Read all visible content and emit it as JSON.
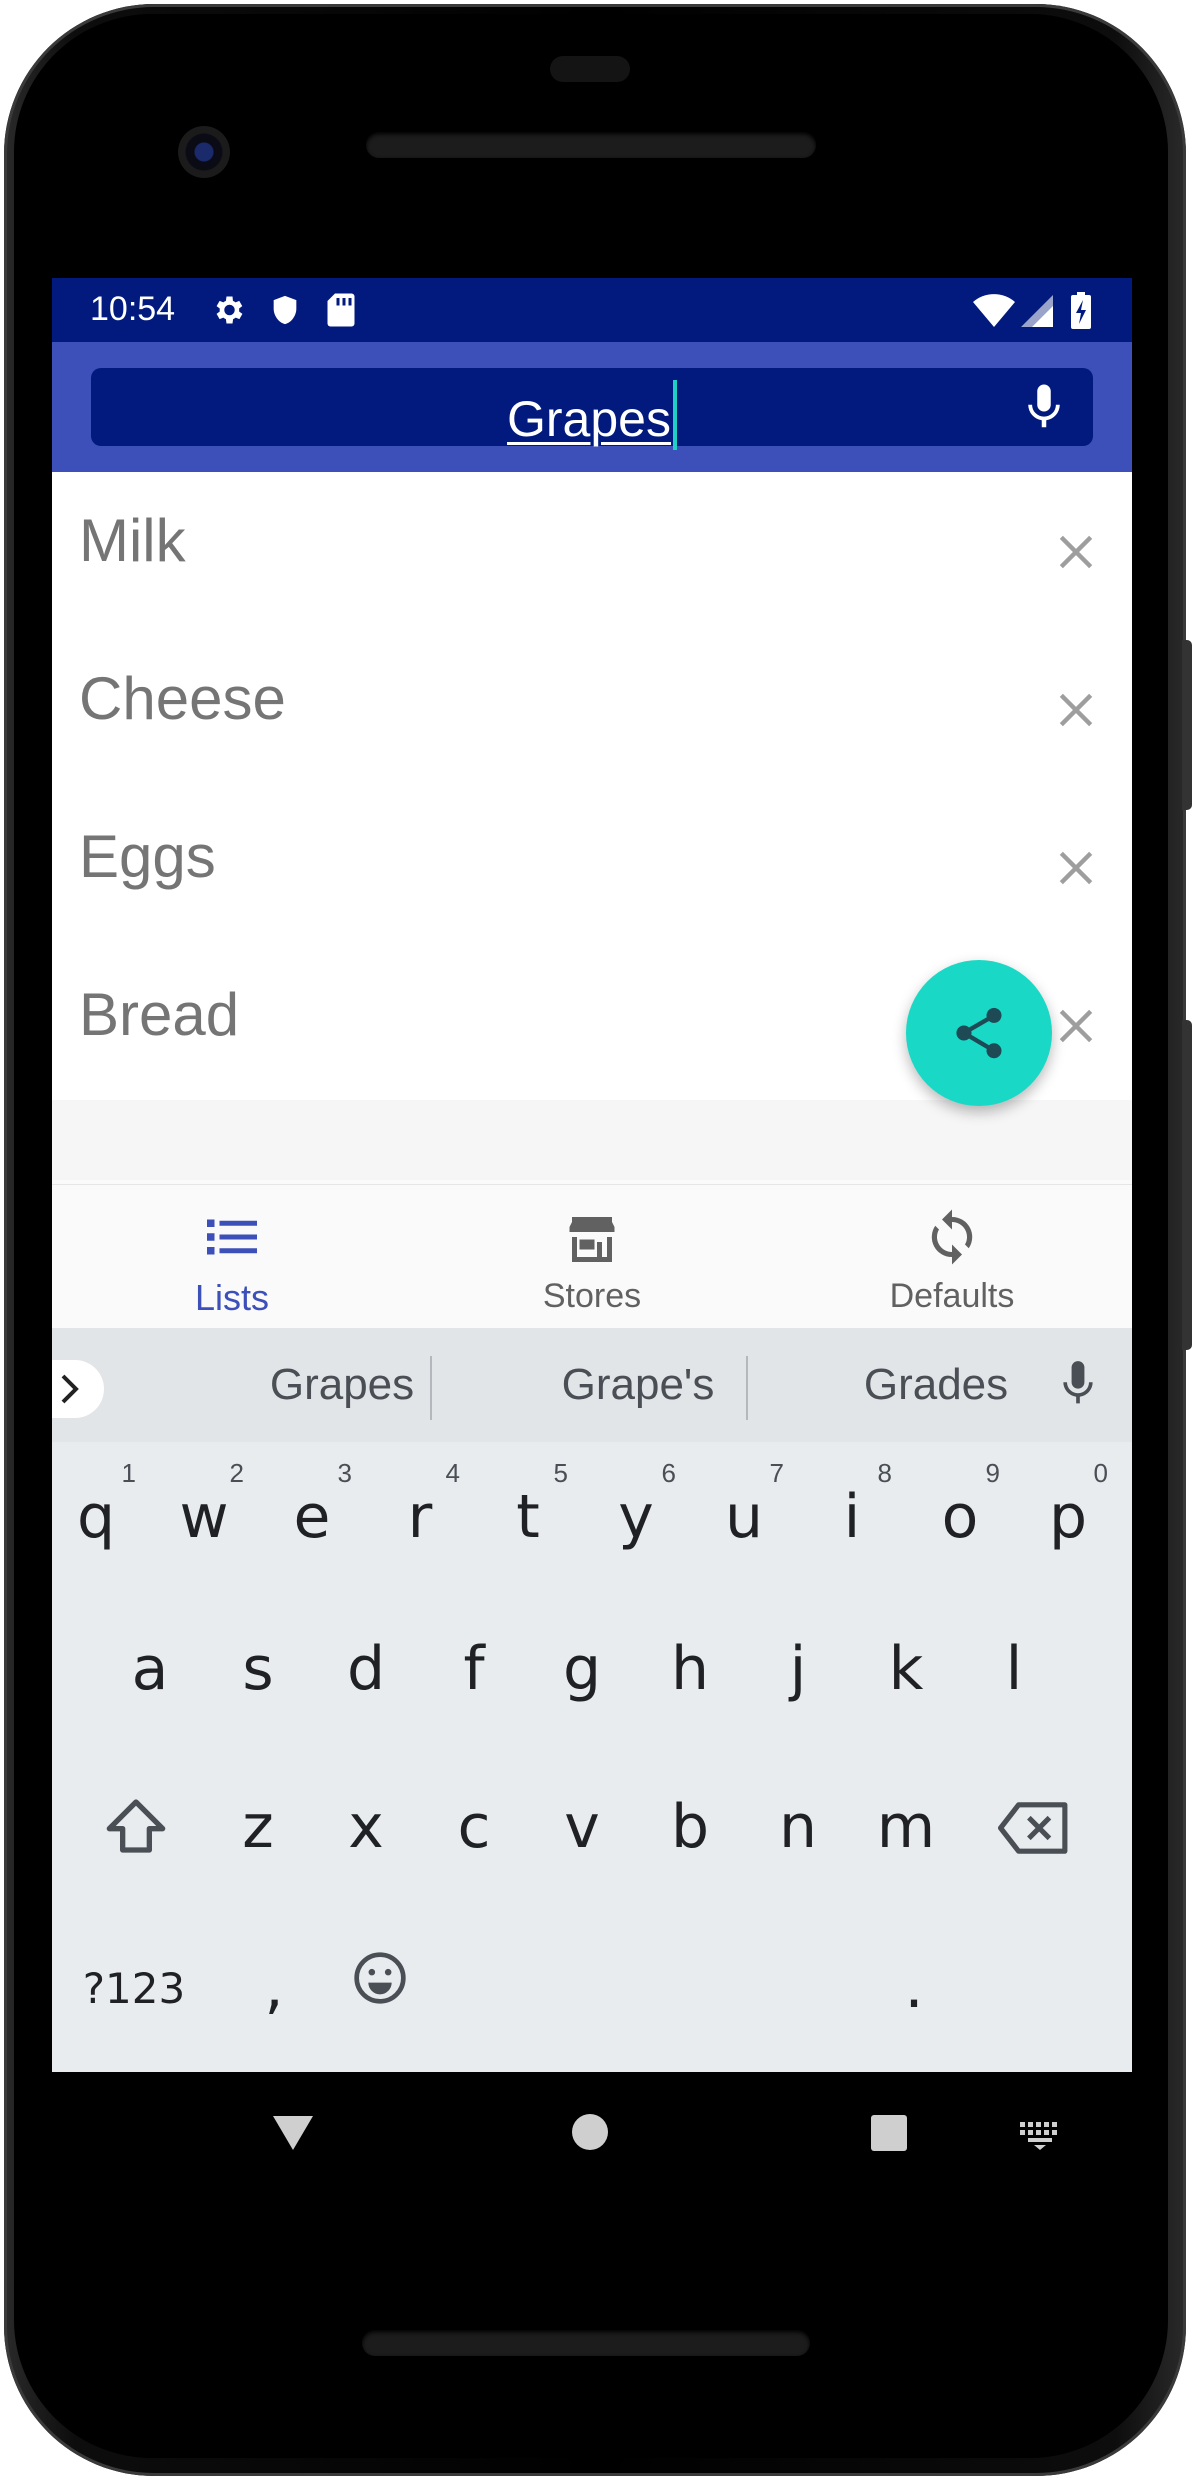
{
  "status_bar": {
    "time": "10:54",
    "left_icons": [
      "gear-icon",
      "shield-icon",
      "sd-card-icon"
    ],
    "right_icons": [
      "wifi-icon",
      "signal-icon",
      "battery-charging-icon"
    ]
  },
  "search": {
    "value": "Grapes",
    "mic_icon": "mic-icon"
  },
  "list": {
    "items": [
      {
        "label": "Milk"
      },
      {
        "label": "Cheese"
      },
      {
        "label": "Eggs"
      },
      {
        "label": "Bread"
      }
    ],
    "remove_icon": "close-icon"
  },
  "fab": {
    "icon": "share-icon",
    "color": "#19d8c6"
  },
  "bottom_nav": {
    "items": [
      {
        "label": "Lists",
        "icon": "list-icon",
        "active": true
      },
      {
        "label": "Stores",
        "icon": "store-icon",
        "active": false
      },
      {
        "label": "Defaults",
        "icon": "refresh-icon",
        "active": false
      }
    ]
  },
  "keyboard": {
    "suggestions": [
      "Grapes",
      "Grape's",
      "Grades"
    ],
    "row1": [
      {
        "key": "q",
        "hint": "1"
      },
      {
        "key": "w",
        "hint": "2"
      },
      {
        "key": "e",
        "hint": "3"
      },
      {
        "key": "r",
        "hint": "4"
      },
      {
        "key": "t",
        "hint": "5"
      },
      {
        "key": "y",
        "hint": "6"
      },
      {
        "key": "u",
        "hint": "7"
      },
      {
        "key": "i",
        "hint": "8"
      },
      {
        "key": "o",
        "hint": "9"
      },
      {
        "key": "p",
        "hint": "0"
      }
    ],
    "row2": [
      "a",
      "s",
      "d",
      "f",
      "g",
      "h",
      "j",
      "k",
      "l"
    ],
    "row3": [
      "z",
      "x",
      "c",
      "v",
      "b",
      "n",
      "m"
    ],
    "symbols_label": "?123",
    "comma": ",",
    "period": "."
  },
  "colors": {
    "status_bar": "#021a7e",
    "app_bar": "#3d4fb8",
    "accent": "#19d8c6",
    "enter_key": "#3bbfae"
  }
}
